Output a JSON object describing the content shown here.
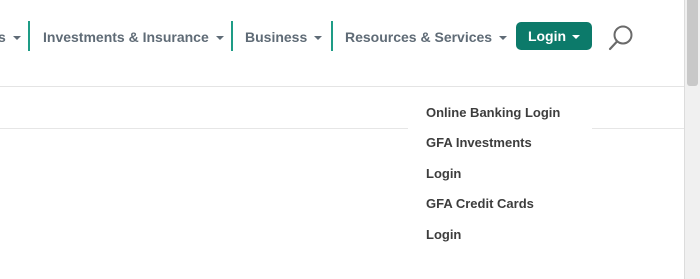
{
  "nav": {
    "items": [
      {
        "label": "s"
      },
      {
        "label": "Investments & Insurance"
      },
      {
        "label": "Business"
      },
      {
        "label": "Resources & Services"
      }
    ],
    "login_label": "Login",
    "accent_color": "#0c7a6a",
    "divider_color": "#1e9c86"
  },
  "login_menu": {
    "items": [
      {
        "label": "Online Banking Login"
      },
      {
        "label": "GFA Investments"
      },
      {
        "label": "Login"
      },
      {
        "label": "GFA Credit Cards"
      },
      {
        "label": "Login"
      }
    ]
  }
}
